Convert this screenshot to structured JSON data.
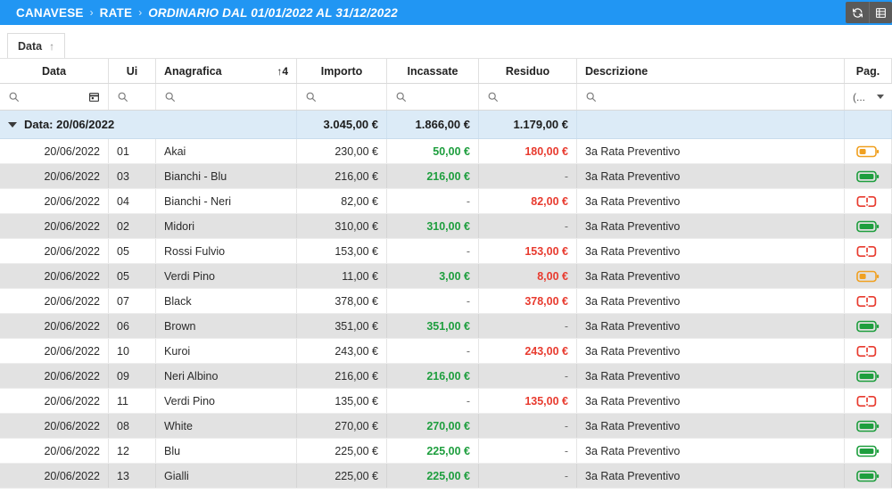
{
  "topbar": {
    "breadcrumb": [
      "CANAVESE",
      "RATE",
      "ORDINARIO DAL 01/01/2022 AL 31/12/2022"
    ],
    "separator": "›",
    "accent_color": "#2196f3",
    "actions": [
      {
        "name": "refresh-icon",
        "label": ""
      },
      {
        "name": "grid-icon",
        "label": ""
      }
    ]
  },
  "group_chip": {
    "label": "Data",
    "sort_arrow": "↑"
  },
  "columns": [
    {
      "key": "data",
      "label": "Data",
      "sort": ""
    },
    {
      "key": "ui",
      "label": "Ui",
      "sort": ""
    },
    {
      "key": "anagrafica",
      "label": "Anagrafica",
      "sort": "↑4"
    },
    {
      "key": "importo",
      "label": "Importo",
      "sort": ""
    },
    {
      "key": "incassate",
      "label": "Incassate",
      "sort": ""
    },
    {
      "key": "residuo",
      "label": "Residuo",
      "sort": ""
    },
    {
      "key": "descrizione",
      "label": "Descrizione",
      "sort": ""
    },
    {
      "key": "pag",
      "label": "Pag.",
      "sort": ""
    }
  ],
  "filters": {
    "data": "",
    "ui": "",
    "anagrafica": "",
    "importo": "",
    "incassate": "",
    "residuo": "",
    "descrizione": "",
    "pag": "(..."
  },
  "group": {
    "label": "Data: 20/06/2022",
    "importo": "3.045,00 €",
    "incassate": "1.866,00 €",
    "residuo": "1.179,00 €"
  },
  "colors": {
    "green": "#1e9e3e",
    "red": "#e83b2f",
    "orange": "#f0a020",
    "group_bg": "#dcebf7",
    "alt_row_bg": "#e2e2e2"
  },
  "rows": [
    {
      "data": "20/06/2022",
      "ui": "01",
      "anagrafica": "Akai",
      "importo": "230,00 €",
      "incassate": "50,00 €",
      "incassate_state": "green",
      "residuo": "180,00 €",
      "residuo_state": "red",
      "descrizione": "3a Rata Preventivo",
      "pag": "partial"
    },
    {
      "data": "20/06/2022",
      "ui": "03",
      "anagrafica": "Bianchi - Blu",
      "importo": "216,00 €",
      "incassate": "216,00 €",
      "incassate_state": "green",
      "residuo": "-",
      "residuo_state": "dash",
      "descrizione": "3a Rata Preventivo",
      "pag": "full"
    },
    {
      "data": "20/06/2022",
      "ui": "04",
      "anagrafica": "Bianchi - Neri",
      "importo": "82,00 €",
      "incassate": "-",
      "incassate_state": "dash",
      "residuo": "82,00 €",
      "residuo_state": "red",
      "descrizione": "3a Rata Preventivo",
      "pag": "empty"
    },
    {
      "data": "20/06/2022",
      "ui": "02",
      "anagrafica": "Midori",
      "importo": "310,00 €",
      "incassate": "310,00 €",
      "incassate_state": "green",
      "residuo": "-",
      "residuo_state": "dash",
      "descrizione": "3a Rata Preventivo",
      "pag": "full"
    },
    {
      "data": "20/06/2022",
      "ui": "05",
      "anagrafica": "Rossi Fulvio",
      "importo": "153,00 €",
      "incassate": "-",
      "incassate_state": "dash",
      "residuo": "153,00 €",
      "residuo_state": "red",
      "descrizione": "3a Rata Preventivo",
      "pag": "empty"
    },
    {
      "data": "20/06/2022",
      "ui": "05",
      "anagrafica": "Verdi Pino",
      "importo": "11,00 €",
      "incassate": "3,00 €",
      "incassate_state": "green",
      "residuo": "8,00 €",
      "residuo_state": "red",
      "descrizione": "3a Rata Preventivo",
      "pag": "partial"
    },
    {
      "data": "20/06/2022",
      "ui": "07",
      "anagrafica": "Black",
      "importo": "378,00 €",
      "incassate": "-",
      "incassate_state": "dash",
      "residuo": "378,00 €",
      "residuo_state": "red",
      "descrizione": "3a Rata Preventivo",
      "pag": "empty"
    },
    {
      "data": "20/06/2022",
      "ui": "06",
      "anagrafica": "Brown",
      "importo": "351,00 €",
      "incassate": "351,00 €",
      "incassate_state": "green",
      "residuo": "-",
      "residuo_state": "dash",
      "descrizione": "3a Rata Preventivo",
      "pag": "full"
    },
    {
      "data": "20/06/2022",
      "ui": "10",
      "anagrafica": "Kuroi",
      "importo": "243,00 €",
      "incassate": "-",
      "incassate_state": "dash",
      "residuo": "243,00 €",
      "residuo_state": "red",
      "descrizione": "3a Rata Preventivo",
      "pag": "empty"
    },
    {
      "data": "20/06/2022",
      "ui": "09",
      "anagrafica": "Neri Albino",
      "importo": "216,00 €",
      "incassate": "216,00 €",
      "incassate_state": "green",
      "residuo": "-",
      "residuo_state": "dash",
      "descrizione": "3a Rata Preventivo",
      "pag": "full"
    },
    {
      "data": "20/06/2022",
      "ui": "11",
      "anagrafica": "Verdi Pino",
      "importo": "135,00 €",
      "incassate": "-",
      "incassate_state": "dash",
      "residuo": "135,00 €",
      "residuo_state": "red",
      "descrizione": "3a Rata Preventivo",
      "pag": "empty"
    },
    {
      "data": "20/06/2022",
      "ui": "08",
      "anagrafica": "White",
      "importo": "270,00 €",
      "incassate": "270,00 €",
      "incassate_state": "green",
      "residuo": "-",
      "residuo_state": "dash",
      "descrizione": "3a Rata Preventivo",
      "pag": "full"
    },
    {
      "data": "20/06/2022",
      "ui": "12",
      "anagrafica": "Blu",
      "importo": "225,00 €",
      "incassate": "225,00 €",
      "incassate_state": "green",
      "residuo": "-",
      "residuo_state": "dash",
      "descrizione": "3a Rata Preventivo",
      "pag": "full"
    },
    {
      "data": "20/06/2022",
      "ui": "13",
      "anagrafica": "Gialli",
      "importo": "225,00 €",
      "incassate": "225,00 €",
      "incassate_state": "green",
      "residuo": "-",
      "residuo_state": "dash",
      "descrizione": "3a Rata Preventivo",
      "pag": "full"
    }
  ]
}
